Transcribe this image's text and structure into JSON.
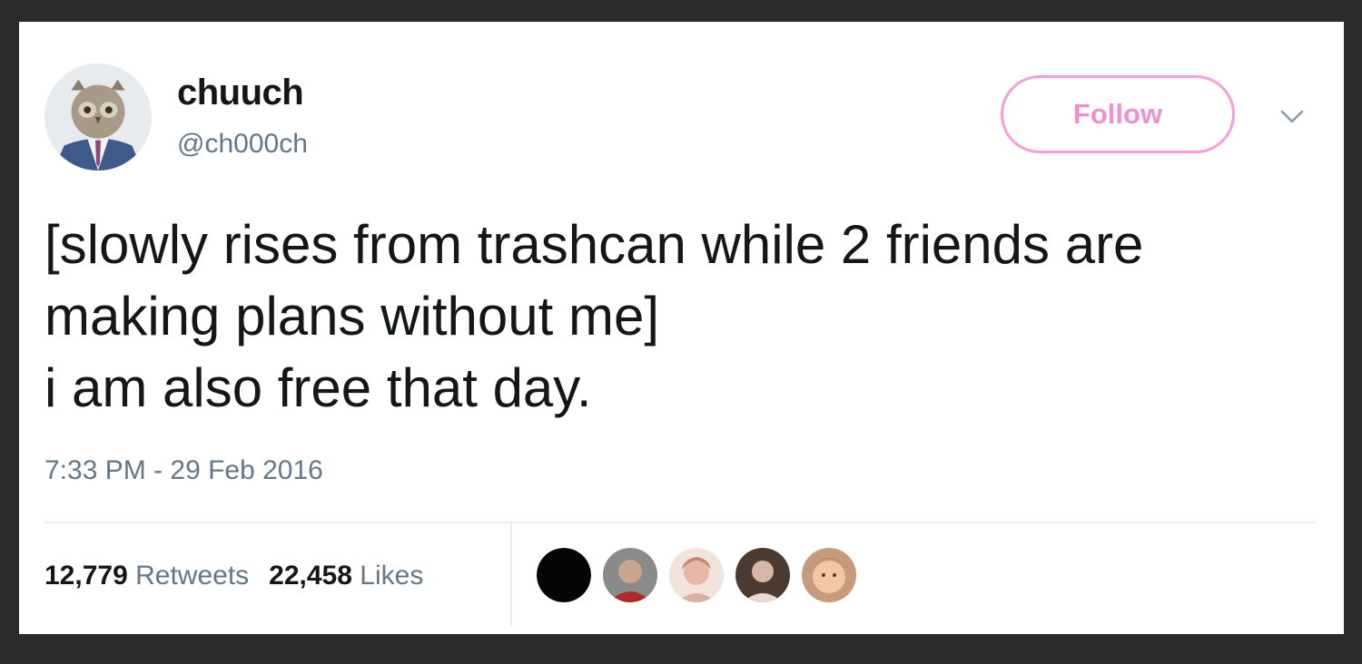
{
  "tweet": {
    "author": {
      "display_name": "chuuch",
      "handle": "@ch000ch",
      "avatar_icon": "owl-in-suit-avatar"
    },
    "follow_label": "Follow",
    "menu_icon": "chevron-down-icon",
    "text_lines": [
      "[slowly rises from trashcan while 2 friends are",
      "making plans without me]",
      "i am also free that day."
    ],
    "timestamp": "7:33 PM - 29 Feb 2016",
    "stats": {
      "retweets_count": "12,779",
      "retweets_label": "Retweets",
      "likes_count": "22,458",
      "likes_label": "Likes"
    },
    "likers_count_shown": 5
  },
  "colors": {
    "accent": "#ee8fd3",
    "text": "#14171a",
    "muted": "#657786",
    "background": "#2b2b2b"
  }
}
